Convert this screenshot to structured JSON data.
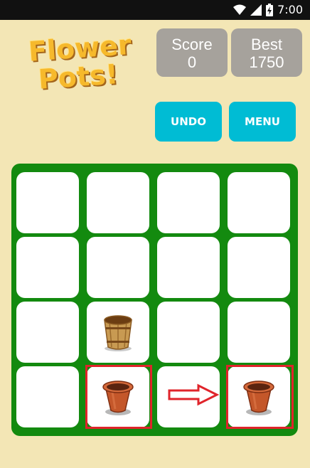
{
  "status_bar": {
    "time": "7:00",
    "icons": [
      "wifi-icon",
      "signal-icon",
      "battery-charging-icon"
    ]
  },
  "logo": {
    "line1": "Flower",
    "line2": "Pots!"
  },
  "score": {
    "label": "Score",
    "value": "0"
  },
  "best": {
    "label": "Best",
    "value": "1750"
  },
  "buttons": {
    "undo": "UNDO",
    "menu": "MENU"
  },
  "colors": {
    "background": "#f3e6b5",
    "board": "#138a0f",
    "button": "#00bcd4",
    "score_box": "#a6a29c",
    "highlight": "#e0242b"
  },
  "board": {
    "rows": 4,
    "cols": 4,
    "tiles": [
      {
        "row": 3,
        "col": 2,
        "item": "wooden-bucket"
      },
      {
        "row": 4,
        "col": 2,
        "item": "clay-pot"
      },
      {
        "row": 4,
        "col": 4,
        "item": "clay-pot"
      }
    ],
    "hint": {
      "from": {
        "row": 4,
        "col": 2
      },
      "to": {
        "row": 4,
        "col": 4
      },
      "direction": "right"
    }
  }
}
